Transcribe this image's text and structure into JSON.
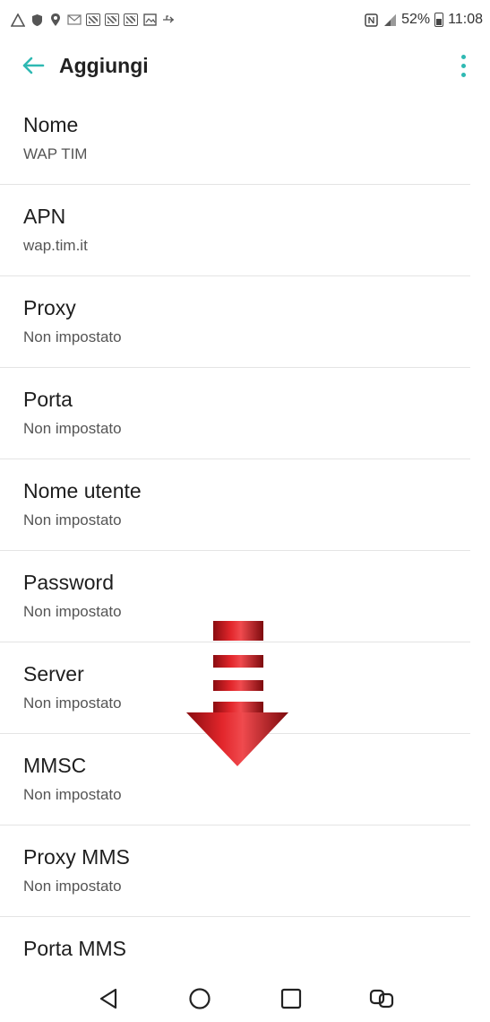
{
  "status_bar": {
    "battery_text": "52%",
    "time": "11:08",
    "left_icons": [
      "warning-icon",
      "shield-icon",
      "location-icon",
      "message-icon",
      "image-icon",
      "image-icon",
      "image-icon",
      "gallery-icon",
      "usb-icon"
    ],
    "right_icons": [
      "nfc-icon",
      "signal-icon",
      "battery-icon"
    ]
  },
  "app_bar": {
    "title": "Aggiungi",
    "accent_color": "#2fb9b3"
  },
  "settings": [
    {
      "label": "Nome",
      "value": "WAP TIM"
    },
    {
      "label": "APN",
      "value": "wap.tim.it"
    },
    {
      "label": "Proxy",
      "value": "Non impostato"
    },
    {
      "label": "Porta",
      "value": "Non impostato"
    },
    {
      "label": "Nome utente",
      "value": "Non impostato"
    },
    {
      "label": "Password",
      "value": "Non impostato"
    },
    {
      "label": "Server",
      "value": "Non impostato"
    },
    {
      "label": "MMSC",
      "value": "Non impostato"
    },
    {
      "label": "Proxy MMS",
      "value": "Non impostato"
    },
    {
      "label": "Porta MMS",
      "value": ""
    }
  ],
  "overlay": {
    "icon": "scroll-down-arrow-icon",
    "color": "#c4161c"
  },
  "nav_bar": {
    "buttons": [
      "back-icon",
      "home-icon",
      "recents-icon",
      "dual-window-icon"
    ]
  }
}
